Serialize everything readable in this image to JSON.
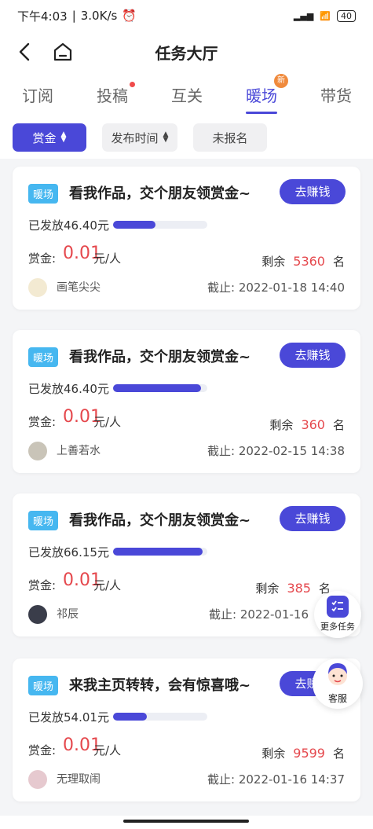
{
  "status": {
    "time": "下午4:03",
    "speed": "3.0K/s",
    "battery": "40"
  },
  "header": {
    "title": "任务大厅"
  },
  "tabs": [
    {
      "label": "订阅"
    },
    {
      "label": "投稿"
    },
    {
      "label": "互关"
    },
    {
      "label": "暖场",
      "badge": "新"
    },
    {
      "label": "带货"
    }
  ],
  "filters": [
    {
      "label": "赏金"
    },
    {
      "label": "发布时间"
    },
    {
      "label": "未报名"
    }
  ],
  "cards": [
    {
      "tag": "暖场",
      "title": "看我作品，交个朋友领赏金~",
      "button": "去赚钱",
      "issued": "已发放46.40元",
      "progress": 0.45,
      "reward_label": "赏金:",
      "reward": "0.01",
      "reward_unit": "元/人",
      "remaining_label": "剩余",
      "remaining": "5360",
      "remaining_unit": "名",
      "user": "画笔尖尖",
      "deadline": "截止: 2022-01-18 14:40"
    },
    {
      "tag": "暖场",
      "title": "看我作品，交个朋友领赏金~",
      "button": "去赚钱",
      "issued": "已发放46.40元",
      "progress": 0.93,
      "reward_label": "赏金:",
      "reward": "0.01",
      "reward_unit": "元/人",
      "remaining_label": "剩余",
      "remaining": "360",
      "remaining_unit": "名",
      "user": "上善若水",
      "deadline": "截止: 2022-02-15 14:38"
    },
    {
      "tag": "暖场",
      "title": "看我作品，交个朋友领赏金~",
      "button": "去赚钱",
      "issued": "已发放66.15元",
      "progress": 0.95,
      "reward_label": "赏金:",
      "reward": "0.01",
      "reward_unit": "元/人",
      "remaining_label": "剩余",
      "remaining": "385",
      "remaining_unit": "名",
      "user": "祁辰",
      "deadline": "截止: 2022-01-16"
    },
    {
      "tag": "暖场",
      "title": "来我主页转转，会有惊喜哦~",
      "button": "去赚钱",
      "issued": "已发放54.01元",
      "progress": 0.36,
      "reward_label": "赏金:",
      "reward": "0.01",
      "reward_unit": "元/人",
      "remaining_label": "剩余",
      "remaining": "9599",
      "remaining_unit": "名",
      "user": "无理取闹",
      "deadline": "截止: 2022-01-16 14:37"
    }
  ],
  "floating": {
    "more_tasks": "更多任务",
    "service": "客服"
  },
  "colors": {
    "accent": "#4a48d8",
    "tag": "#46b7f0",
    "reward": "#e5484d"
  }
}
